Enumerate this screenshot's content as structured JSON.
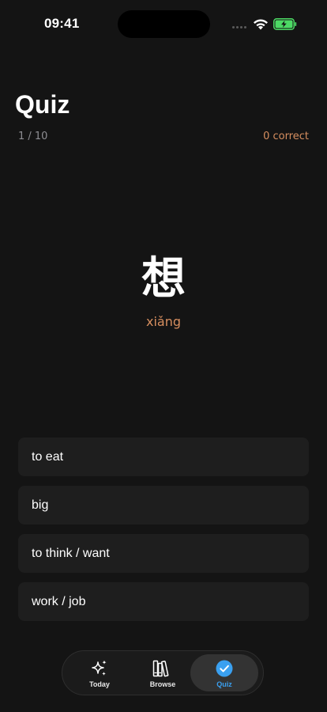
{
  "status_bar": {
    "time": "09:41"
  },
  "header": {
    "title": "Quiz",
    "progress": "1 / 10",
    "correct": "0 correct"
  },
  "card": {
    "hanzi": "想",
    "pinyin": "xiǎng"
  },
  "options": [
    {
      "label": "to eat"
    },
    {
      "label": "big"
    },
    {
      "label": "to think / want"
    },
    {
      "label": "work / job"
    }
  ],
  "tab_bar": {
    "items": [
      {
        "label": "Today",
        "icon": "sparkles-icon"
      },
      {
        "label": "Browse",
        "icon": "books-icon"
      },
      {
        "label": "Quiz",
        "icon": "checkmark-circle-icon",
        "selected": true
      }
    ]
  },
  "colors": {
    "accent_orange": "#d68e5f",
    "accent_blue": "#3aa0f0",
    "battery_green": "#4cd964",
    "background": "#141414"
  }
}
